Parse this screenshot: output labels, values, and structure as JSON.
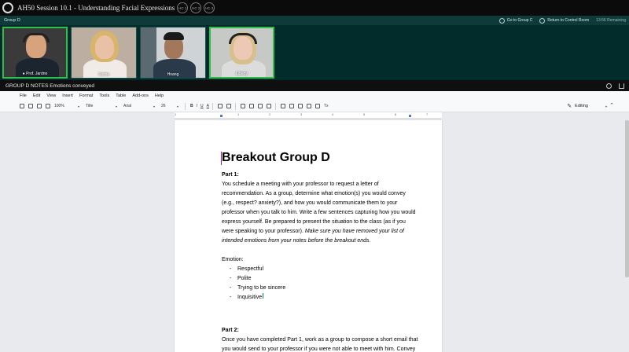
{
  "topbar": {
    "title": "AH50 Session 10.1 - Understanding Facial Expressions",
    "badges": [
      "HC 1",
      "HC 2",
      "HC 3"
    ]
  },
  "groupbar": {
    "label": "Group D",
    "go_to": "Go to Group C",
    "return": "Return to Control Room",
    "remaining": "13:56 Remaining"
  },
  "videos": [
    {
      "name": "● Prof. Jardno",
      "speaking": true
    },
    {
      "name": "Sasha",
      "speaking": false
    },
    {
      "name": "Hoang",
      "speaking": false
    },
    {
      "name": "Liberty",
      "speaking": true
    }
  ],
  "notes": {
    "title": "GROUP D NOTES Emotions conveyed"
  },
  "menubar": {
    "items": [
      "File",
      "Edit",
      "View",
      "Insert",
      "Format",
      "Tools",
      "Table",
      "Add-ons",
      "Help"
    ]
  },
  "toolbar": {
    "zoom": "100%",
    "style": "Title",
    "font": "Arial",
    "size": "26",
    "bold": "B",
    "italic": "I",
    "underline": "U",
    "text_color": "A",
    "clear": "Tx",
    "editing": "Editing"
  },
  "ruler": {
    "numbers": [
      "1",
      "1",
      "2",
      "3",
      "4",
      "5",
      "6",
      "7"
    ]
  },
  "doc": {
    "title": "Breakout Group D",
    "part1_head": "Part 1:",
    "part1_text": "You schedule a meeting with your professor to request a letter of recommendation. As a group, determine what emotion(s) you would convey (e.g., respect? anxiety?), and how you would communicate them to your professor when you talk to him. Write a few sentences capturing how you would express yourself. Be prepared to present the situation to the class (as if you were speaking to your professor).",
    "part1_italic": "Make sure you have removed your list of intended emotions from your notes before the breakout ends.",
    "emotion_label": "Emotion:",
    "emotions": [
      "Respectful",
      "Polite",
      "Trying to be sincere",
      "Inquisitive"
    ],
    "part2_head": "Part 2:",
    "part2_text": "Once you have completed Part 1, work as a group to compose a short email that you would send to your professor if you were not able to meet with him. Convey"
  }
}
